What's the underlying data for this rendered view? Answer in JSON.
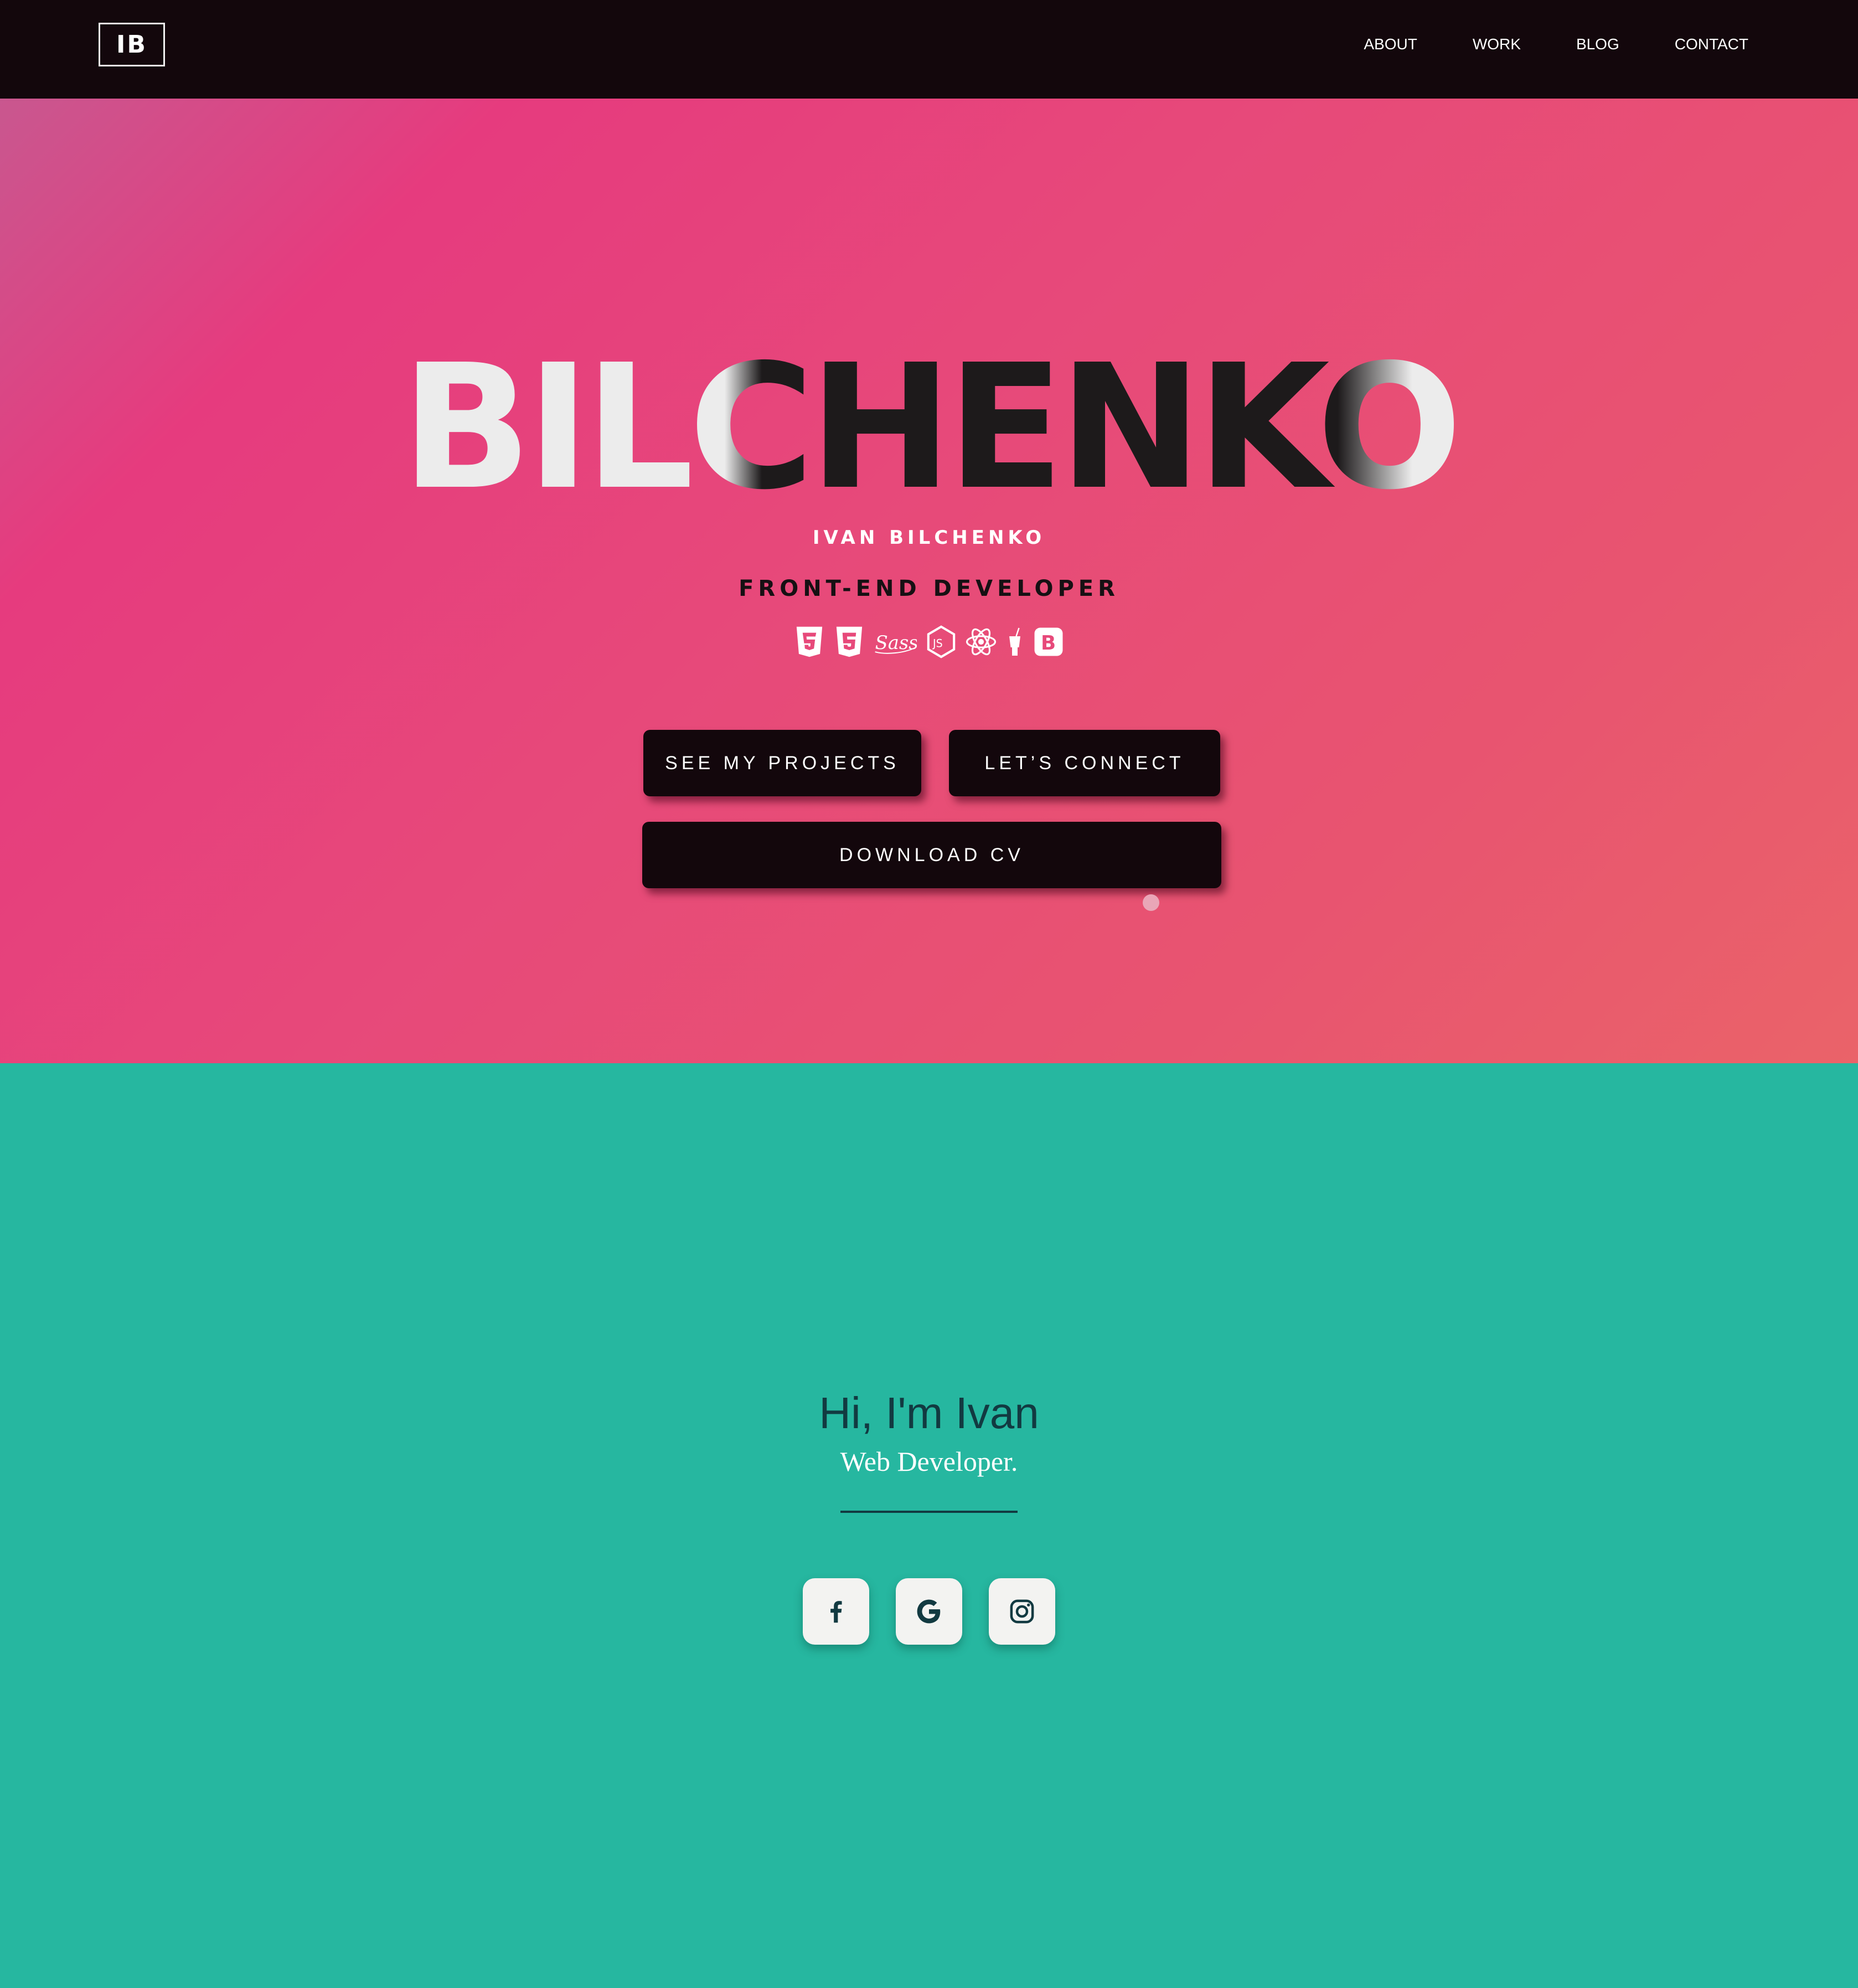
{
  "nav": {
    "logo": "IB",
    "links": [
      "ABOUT",
      "WORK",
      "BLOG",
      "CONTACT"
    ]
  },
  "hero": {
    "big_name": "BILCHENKO",
    "sub_name": "IVAN BILCHENKO",
    "role": "FRONT-END DEVELOPER",
    "tech_icons": [
      "html5-icon",
      "css3-icon",
      "sass-icon",
      "nodejs-icon",
      "react-icon",
      "gulp-icon",
      "bootstrap-icon"
    ],
    "buttons": {
      "projects": "SEE MY PROJECTS",
      "connect": "LET’S CONNECT",
      "cv": "DOWNLOAD CV"
    }
  },
  "about": {
    "greeting": "Hi, I'm Ivan",
    "title": "Web Developer.",
    "socials": [
      "facebook-icon",
      "google-icon",
      "instagram-icon"
    ]
  },
  "colors": {
    "nav_bg": "#13070c",
    "hero_gradient_start": "#c9578f",
    "hero_gradient_mid": "#e63b7e",
    "hero_gradient_end": "#ea6369",
    "about_bg": "#26b7a0",
    "dark_text": "#123a41"
  }
}
